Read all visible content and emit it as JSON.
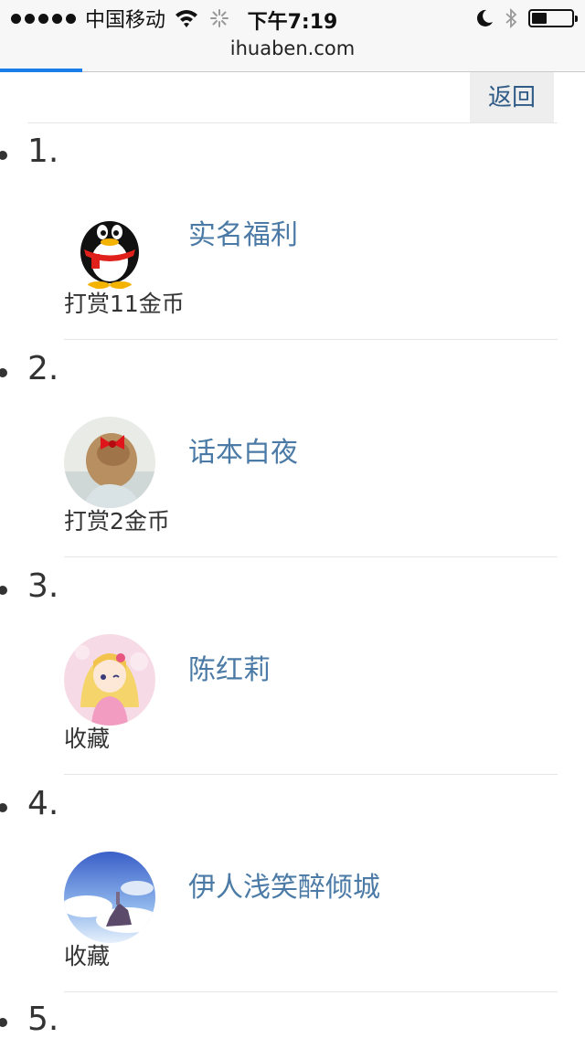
{
  "status_bar": {
    "carrier": "中国移动",
    "time": "下午7:19",
    "icons": [
      "signal-dots-icon",
      "wifi-icon",
      "loading-spinner-icon",
      "moon-icon",
      "bluetooth-icon",
      "battery-icon"
    ]
  },
  "browser": {
    "url": "ihuaben.com",
    "load_progress_percent": 14
  },
  "page": {
    "back_label": "返回",
    "items": [
      {
        "num": "1.",
        "name": "实名福利",
        "action": "打赏11金币",
        "avatar": "qq-penguin-avatar"
      },
      {
        "num": "2.",
        "name": "话本白夜",
        "action": "打赏2金币",
        "avatar": "girl-red-bow-avatar"
      },
      {
        "num": "3.",
        "name": "陈红莉",
        "action": "收藏",
        "avatar": "anime-girl-avatar"
      },
      {
        "num": "4.",
        "name": "伊人浅笑醉倾城",
        "action": "收藏",
        "avatar": "sky-landscape-avatar"
      }
    ],
    "next_num": "5."
  },
  "colors": {
    "link": "#4a7aa5",
    "back_text": "#2f5b86",
    "progress": "#1a7de8"
  }
}
